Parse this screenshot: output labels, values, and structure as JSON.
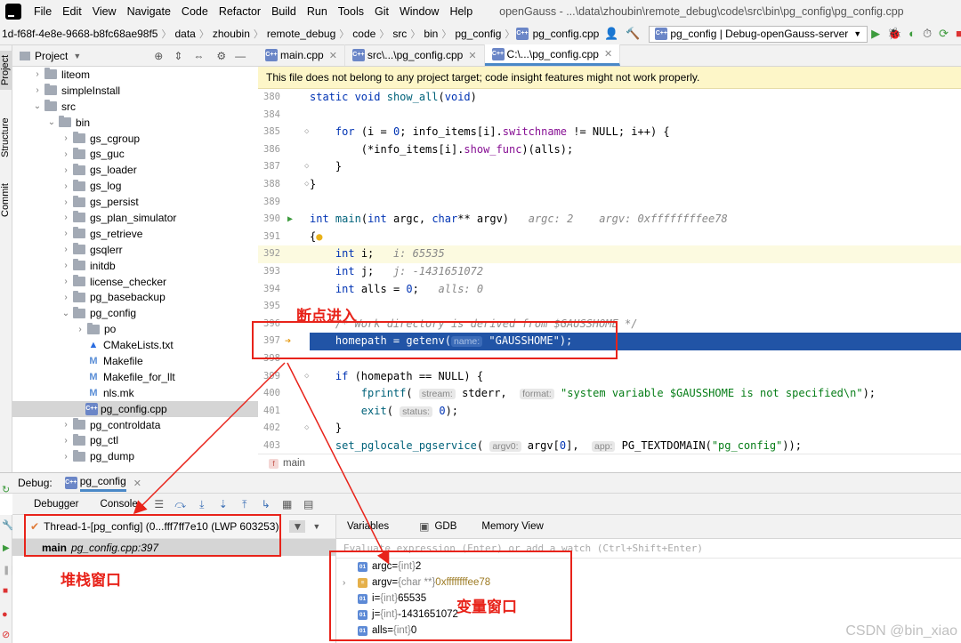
{
  "menu": {
    "items": [
      "File",
      "Edit",
      "View",
      "Navigate",
      "Code",
      "Refactor",
      "Build",
      "Run",
      "Tools",
      "Git",
      "Window",
      "Help"
    ],
    "title": "openGauss - ...\\data\\zhoubin\\remote_debug\\code\\src\\bin\\pg_config\\pg_config.cpp"
  },
  "nav": {
    "crumbs": [
      "1d-f68f-4e8e-9668-b8fc68ae98f5",
      "data",
      "zhoubin",
      "remote_debug",
      "code",
      "src",
      "bin",
      "pg_config",
      "pg_config.cpp"
    ],
    "run_config": "pg_config | Debug-openGauss-server"
  },
  "sidebar": {
    "tabs": [
      "Project",
      "Structure",
      "Commit"
    ]
  },
  "project": {
    "header": "Project",
    "tree": [
      {
        "label": "liteom",
        "indent": 1,
        "type": "folder",
        "arrow": "›"
      },
      {
        "label": "simpleInstall",
        "indent": 1,
        "type": "folder",
        "arrow": "›"
      },
      {
        "label": "src",
        "indent": 1,
        "type": "folder",
        "arrow": "⌄"
      },
      {
        "label": "bin",
        "indent": 2,
        "type": "folder",
        "arrow": "⌄"
      },
      {
        "label": "gs_cgroup",
        "indent": 3,
        "type": "folder",
        "arrow": "›"
      },
      {
        "label": "gs_guc",
        "indent": 3,
        "type": "folder",
        "arrow": "›"
      },
      {
        "label": "gs_loader",
        "indent": 3,
        "type": "folder",
        "arrow": "›"
      },
      {
        "label": "gs_log",
        "indent": 3,
        "type": "folder",
        "arrow": "›"
      },
      {
        "label": "gs_persist",
        "indent": 3,
        "type": "folder",
        "arrow": "›"
      },
      {
        "label": "gs_plan_simulator",
        "indent": 3,
        "type": "folder",
        "arrow": "›"
      },
      {
        "label": "gs_retrieve",
        "indent": 3,
        "type": "folder",
        "arrow": "›"
      },
      {
        "label": "gsqlerr",
        "indent": 3,
        "type": "folder",
        "arrow": "›"
      },
      {
        "label": "initdb",
        "indent": 3,
        "type": "folder",
        "arrow": "›"
      },
      {
        "label": "license_checker",
        "indent": 3,
        "type": "folder",
        "arrow": "›"
      },
      {
        "label": "pg_basebackup",
        "indent": 3,
        "type": "folder",
        "arrow": "›"
      },
      {
        "label": "pg_config",
        "indent": 3,
        "type": "folder",
        "arrow": "⌄"
      },
      {
        "label": "po",
        "indent": 4,
        "type": "folder",
        "arrow": "›"
      },
      {
        "label": "CMakeLists.txt",
        "indent": 4,
        "type": "cmake",
        "arrow": ""
      },
      {
        "label": "Makefile",
        "indent": 4,
        "type": "make",
        "arrow": ""
      },
      {
        "label": "Makefile_for_llt",
        "indent": 4,
        "type": "make",
        "arrow": ""
      },
      {
        "label": "nls.mk",
        "indent": 4,
        "type": "make",
        "arrow": ""
      },
      {
        "label": "pg_config.cpp",
        "indent": 4,
        "type": "cpp",
        "arrow": "",
        "selected": true
      },
      {
        "label": "pg_controldata",
        "indent": 3,
        "type": "folder",
        "arrow": "›"
      },
      {
        "label": "pg_ctl",
        "indent": 3,
        "type": "folder",
        "arrow": "›"
      },
      {
        "label": "pg_dump",
        "indent": 3,
        "type": "folder",
        "arrow": "›"
      }
    ]
  },
  "editor": {
    "tabs": [
      {
        "label": "main.cpp",
        "active": false
      },
      {
        "label": "src\\...\\pg_config.cpp",
        "active": false
      },
      {
        "label": "C:\\...\\pg_config.cpp",
        "active": true
      }
    ],
    "banner": "This file does not belong to any project target; code insight features might not work properly.",
    "breadcrumb": "main"
  },
  "debug": {
    "title": "Debug:",
    "session": "pg_config",
    "tabs": [
      "Debugger",
      "Console"
    ],
    "thread": "Thread-1-[pg_config] (0...fff7ff7e10 (LWP 603253)",
    "frame_fn": "main",
    "frame_loc": "pg_config.cpp:397",
    "var_tabs": [
      "Variables",
      "GDB",
      "Memory View"
    ],
    "eval_placeholder": "Evaluate expression (Enter) or add a watch (Ctrl+Shift+Enter)",
    "variables": [
      {
        "name": "argc",
        "type": "{int}",
        "value": "2",
        "icon": "01",
        "ptr": false,
        "expandable": false
      },
      {
        "name": "argv",
        "type": "{char **}",
        "value": "0xffffffffee78",
        "icon": "≡",
        "ptr": true,
        "expandable": true
      },
      {
        "name": "i",
        "type": "{int}",
        "value": "65535",
        "icon": "01",
        "ptr": false,
        "expandable": false
      },
      {
        "name": "j",
        "type": "{int}",
        "value": "-1431651072",
        "icon": "01",
        "ptr": false,
        "expandable": false
      },
      {
        "name": "alls",
        "type": "{int}",
        "value": "0",
        "icon": "01",
        "ptr": false,
        "expandable": false
      }
    ]
  },
  "annotations": {
    "breakpoint": "断点进入",
    "stack": "堆栈窗口",
    "vars": "变量窗口",
    "color": "#e8231a"
  },
  "watermark": "CSDN @bin_xiao"
}
